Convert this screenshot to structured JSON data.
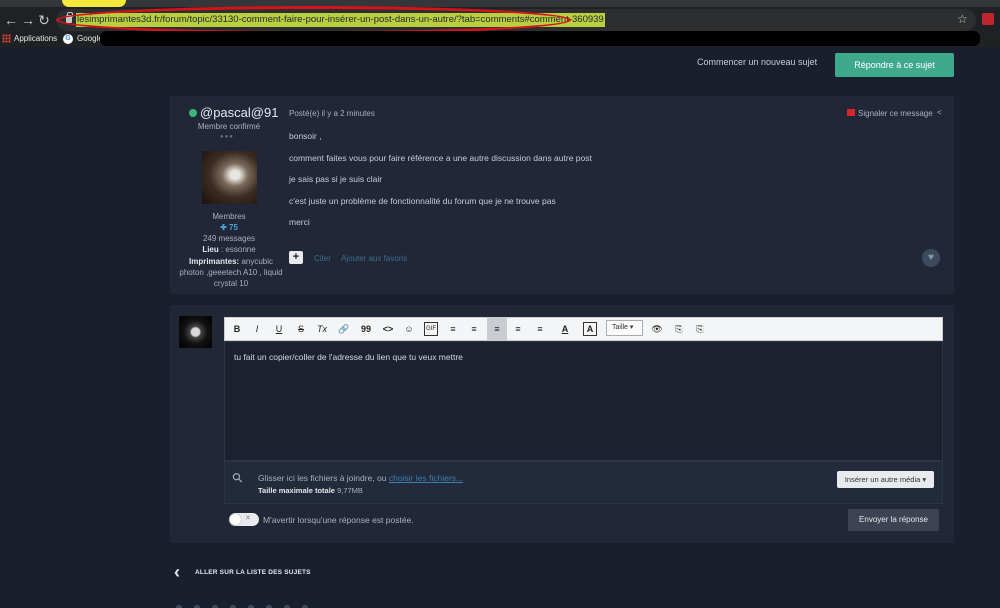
{
  "browser": {
    "url": "lesimprimantes3d.fr/forum/topic/33130-comment-faire-pour-insérer-un-post-dans-un-autre/?tab=comments#comment-360939",
    "bookmarks": [
      "Applications",
      "Google"
    ],
    "icons": [
      "back-icon",
      "forward-icon",
      "reload-icon",
      "lock-icon",
      "star-icon",
      "extension-icon",
      "apps-grid-icon",
      "google-icon"
    ]
  },
  "topbar": {
    "new_topic": "Commencer un nouveau sujet",
    "reply": "Répondre à ce sujet"
  },
  "post": {
    "author": "@pascal@91",
    "role": "Membre confirmé",
    "rank_dots": "●●●",
    "group": "Membres",
    "reputation": "75",
    "messages": "249 messages",
    "location_label": "Lieu",
    "location_value": " : essonne",
    "printers_label": "Imprimantes:",
    "printers_value": " anycubic photon ,geeetech A10 , liquid crystal 10",
    "posted": "Posté(e) il y a 2 minutes",
    "report": "Signaler ce message",
    "lines": [
      "bonsoir ,",
      "comment faites vous pour faire référence a une autre discussion dans autre post",
      "je sais pas si je suis clair",
      "c'est juste un problème de fonctionnalité du forum que je ne trouve pas",
      "merci"
    ],
    "quote": "Citer",
    "favorite": "Ajouter aux favoris"
  },
  "reply": {
    "toolbar": {
      "size_label": "Taille",
      "buttons": [
        "B",
        "I",
        "U",
        "S",
        "Tx",
        "🔗",
        "99",
        "<>",
        "☺",
        "GIF",
        "≡",
        "≡",
        "≡",
        "≡",
        "≡",
        "A",
        "A",
        "👁",
        "⎘",
        "⎘"
      ]
    },
    "editor_text": "tu fait un copier/coller de l'adresse du lien que tu veux mettre",
    "drop_text": "Glisser ici les fichiers à joindre, ou ",
    "choose_files": "choisir les fichiers...",
    "max_size_label": "Taille maximale totale",
    "max_size_value": " 9,77MB",
    "insert_media": "Insérer un autre média ▾",
    "notify": "M'avertir lorsqu'une réponse est postée.",
    "send": "Envoyer la réponse"
  },
  "footer": {
    "back": "ALLER SUR LA LISTE DES SUJETS"
  },
  "colors": {
    "background": "#1a1f2e",
    "panel": "#212737",
    "accent_green": "#3fa98e",
    "url_highlight": "#b9cf3d",
    "annotation_red": "#d8121b"
  }
}
